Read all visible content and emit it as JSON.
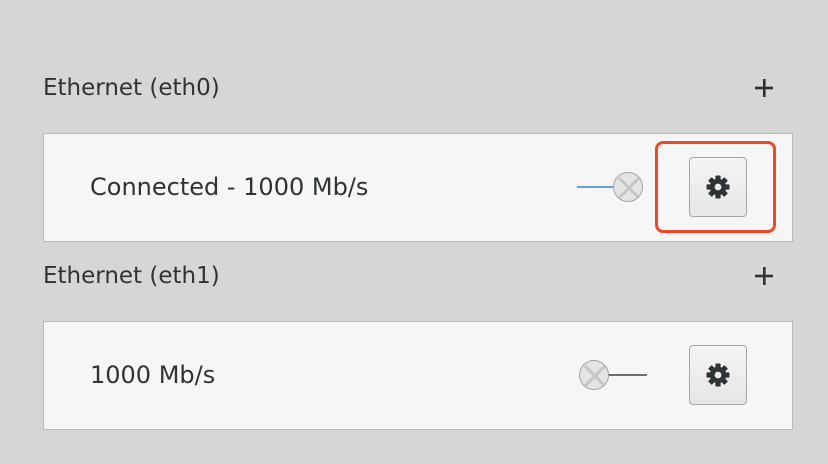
{
  "colors": {
    "background": "#d6d6d6",
    "card": "#f6f6f6",
    "switch_on_track": "#6a9fd4",
    "switch_off_track": "#6f6f6f",
    "highlight": "#ea4a2a"
  },
  "interfaces": [
    {
      "title": "Ethernet (eth0)",
      "add_label": "+",
      "status": "Connected - 1000 Mb/s",
      "switch_on": true,
      "settings_icon": "gear-icon"
    },
    {
      "title": "Ethernet (eth1)",
      "add_label": "+",
      "status": "1000 Mb/s",
      "switch_on": false,
      "settings_icon": "gear-icon"
    }
  ]
}
